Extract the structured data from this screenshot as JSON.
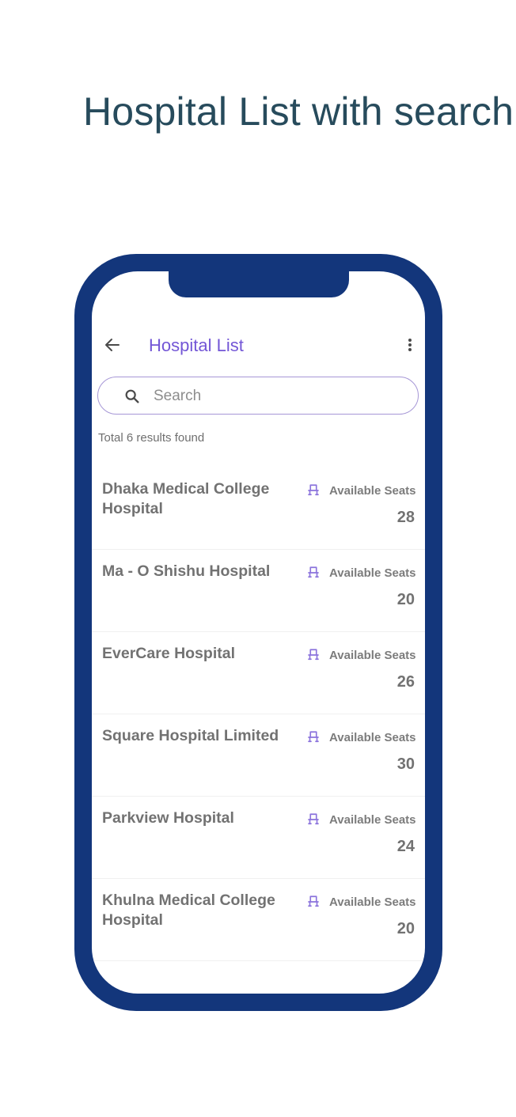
{
  "headline": "Hospital List with search",
  "app_bar": {
    "title": "Hospital List",
    "back_icon": "arrow-left-icon",
    "more_icon": "more-vertical-icon"
  },
  "search": {
    "placeholder": "Search",
    "value": "",
    "icon": "search-icon"
  },
  "results_text": "Total 6 results found",
  "colors": {
    "accent": "#7356d6",
    "frame": "#13367b",
    "headline": "#274b5c"
  },
  "hospitals": [
    {
      "name": "Dhaka Medical College Hospital",
      "seats_label": "Available Seats",
      "seats": "28"
    },
    {
      "name": "Ma - O Shishu Hospital",
      "seats_label": "Available Seats",
      "seats": "20"
    },
    {
      "name": "EverCare Hospital",
      "seats_label": "Available Seats",
      "seats": "26"
    },
    {
      "name": "Square Hospital Limited",
      "seats_label": "Available Seats",
      "seats": "30"
    },
    {
      "name": "Parkview Hospital",
      "seats_label": "Available Seats",
      "seats": "24"
    },
    {
      "name": "Khulna Medical College Hospital",
      "seats_label": "Available Seats",
      "seats": "20"
    }
  ]
}
